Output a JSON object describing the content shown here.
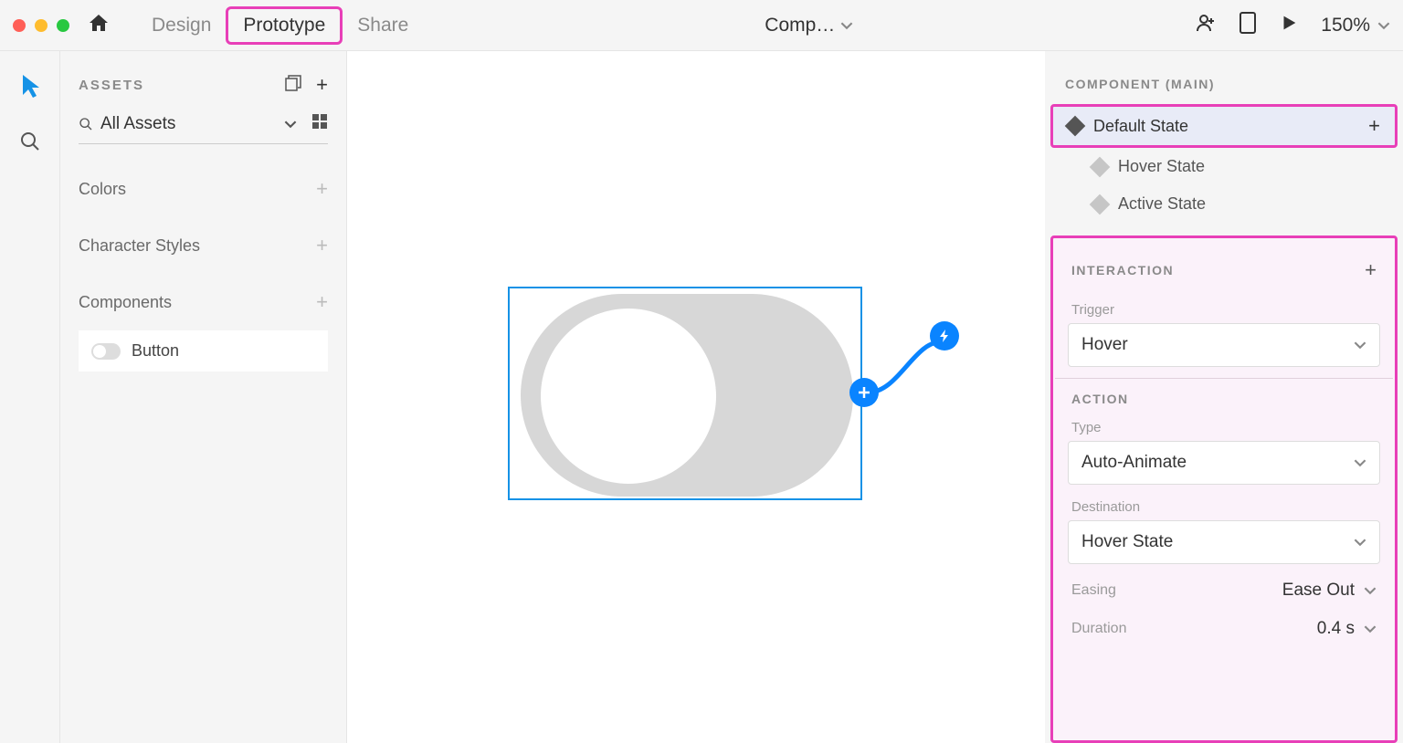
{
  "topbar": {
    "tabs": {
      "design": "Design",
      "prototype": "Prototype",
      "share": "Share"
    },
    "doc_title": "Comp…",
    "zoom": "150%"
  },
  "leftpanel": {
    "title": "ASSETS",
    "filter": "All Assets",
    "sections": {
      "colors": "Colors",
      "charstyles": "Character Styles",
      "components": "Components"
    },
    "component_item": "Button"
  },
  "rightpanel": {
    "component_title": "COMPONENT (MAIN)",
    "states": {
      "default": "Default State",
      "hover": "Hover State",
      "active": "Active State"
    },
    "interaction_title": "INTERACTION",
    "trigger_label": "Trigger",
    "trigger_value": "Hover",
    "action_title": "ACTION",
    "type_label": "Type",
    "type_value": "Auto-Animate",
    "dest_label": "Destination",
    "dest_value": "Hover State",
    "easing_label": "Easing",
    "easing_value": "Ease Out",
    "duration_label": "Duration",
    "duration_value": "0.4 s"
  }
}
